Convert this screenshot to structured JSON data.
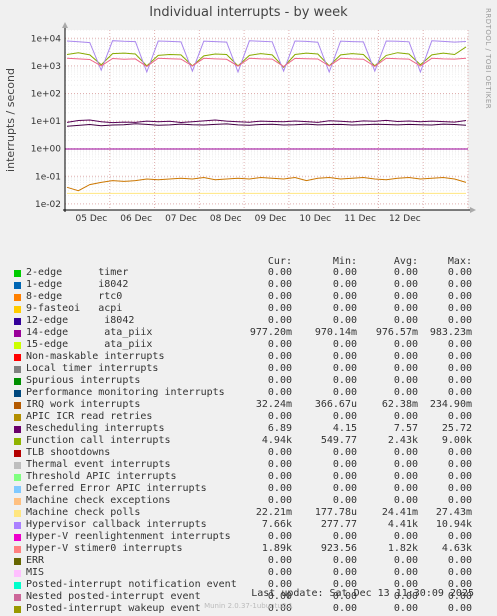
{
  "title": "Individual interrupts - by week",
  "side_label": "RRDTOOL / TOBI OETIKER",
  "chart_data": {
    "type": "line",
    "title": "Individual interrupts - by week",
    "ylabel": "interrupts / second",
    "yscale": "log",
    "ylim": [
      0.006,
      20000
    ],
    "ytick_labels": [
      "1e+04",
      "1e+03",
      "1e+02",
      "1e+01",
      "1e+00",
      "1e-01",
      "1e-02"
    ],
    "ytick_values": [
      10000,
      1000,
      100,
      10,
      1,
      0.1,
      0.01
    ],
    "xtick_labels": [
      "05 Dec",
      "06 Dec",
      "07 Dec",
      "08 Dec",
      "09 Dec",
      "10 Dec",
      "11 Dec",
      "12 Dec"
    ],
    "x_start": "2025-12-04",
    "x_end": "2025-12-13",
    "series": [
      {
        "name": "14-edge ata_piix",
        "color": "#550055",
        "typical": 9.7,
        "min": 0.97014,
        "max": 0.98323,
        "points": [
          9.0,
          10.5,
          11.0,
          9.5,
          8.8,
          9.2,
          9.0,
          10.0,
          9.4,
          9.8,
          8.9,
          9.5,
          10.2,
          11.0,
          10.0,
          9.5,
          9.1,
          10.0,
          9.7,
          9.5,
          10.1,
          9.6,
          9.0,
          10.3,
          9.9,
          9.3,
          10.2,
          9.8,
          10.6,
          9.7,
          10.1,
          9.4,
          10.0,
          9.6,
          9.2,
          10.5
        ]
      },
      {
        "name": "IRQ work interrupts",
        "color": "#cc7700",
        "typical": 0.032,
        "points": [
          0.04,
          0.03,
          0.05,
          0.06,
          0.07,
          0.065,
          0.07,
          0.08,
          0.075,
          0.08,
          0.085,
          0.08,
          0.09,
          0.075,
          0.08,
          0.085,
          0.08,
          0.09,
          0.085,
          0.08,
          0.09,
          0.07,
          0.085,
          0.09,
          0.08,
          0.085,
          0.09,
          0.08,
          0.075,
          0.085,
          0.09,
          0.08,
          0.085,
          0.09,
          0.08,
          0.06
        ]
      },
      {
        "name": "Rescheduling interrupts",
        "color": "#440044",
        "typical": 6.89,
        "points": [
          6.5,
          7.0,
          7.5,
          6.8,
          7.2,
          7.4,
          8.0,
          7.6,
          7.1,
          7.3,
          7.8,
          7.4,
          7.2,
          7.6,
          7.9,
          7.3,
          7.1,
          7.5,
          7.7,
          7.2,
          7.4,
          7.8,
          7.3,
          7.5,
          7.6,
          7.2,
          7.4,
          7.7,
          7.5,
          7.3,
          7.6,
          7.4,
          7.2,
          7.8,
          7.5,
          7.1
        ]
      },
      {
        "name": "Function call interrupts",
        "color": "#88aa00",
        "typical": 4940,
        "points": [
          2600,
          3000,
          2500,
          1100,
          2800,
          2900,
          2700,
          1000,
          2400,
          2600,
          2500,
          1000,
          2300,
          2700,
          2600,
          1000,
          2400,
          2800,
          2500,
          900,
          2600,
          2900,
          2700,
          1000,
          2500,
          2800,
          2600,
          1000,
          2400,
          3000,
          2700,
          1100,
          2500,
          2900,
          2600,
          4900
        ]
      },
      {
        "name": "Machine check polls",
        "color": "#ffe680",
        "typical": 0.02221,
        "points": [
          0.024,
          0.024,
          0.024,
          0.024,
          0.024,
          0.024,
          0.024,
          0.024,
          0.024,
          0.024,
          0.024,
          0.024,
          0.024,
          0.024,
          0.024,
          0.024,
          0.024,
          0.024,
          0.024,
          0.024,
          0.024,
          0.024,
          0.024,
          0.024,
          0.024,
          0.024,
          0.024,
          0.024,
          0.024,
          0.024,
          0.024,
          0.024,
          0.024,
          0.024,
          0.024,
          0.024
        ]
      },
      {
        "name": "Hypervisor callback interrupts",
        "color": "#aa88ee",
        "typical": 7660,
        "points": [
          8000,
          7500,
          7000,
          700,
          8200,
          7800,
          7600,
          600,
          8000,
          7700,
          7400,
          650,
          7900,
          7600,
          7300,
          600,
          8100,
          7800,
          7500,
          650,
          8000,
          7700,
          7200,
          600,
          7900,
          7600,
          7400,
          650,
          8000,
          7800,
          7500,
          600,
          8100,
          7700,
          7300,
          7660
        ]
      },
      {
        "name": "Hyper-V stimer0 interrupts",
        "color": "#ee6688",
        "typical": 1890,
        "points": [
          1900,
          1800,
          1700,
          1000,
          1850,
          1750,
          1800,
          950,
          1900,
          1820,
          1760,
          1000,
          1880,
          1790,
          1740,
          980,
          1900,
          1800,
          1760,
          950,
          1870,
          1820,
          1780,
          1000,
          1890,
          1800,
          1750,
          960,
          1900,
          1810,
          1770,
          990,
          1880,
          1800,
          1760,
          1890
        ]
      }
    ]
  },
  "legend": {
    "headers": {
      "cur": "Cur:",
      "min": "Min:",
      "avg": "Avg:",
      "max": "Max:"
    },
    "rows": [
      {
        "label": "2-edge      timer",
        "color": "#00cc00",
        "cur": "0.00",
        "min": "0.00",
        "avg": "0.00",
        "max": "0.00"
      },
      {
        "label": "1-edge      i8042",
        "color": "#0066b3",
        "cur": "0.00",
        "min": "0.00",
        "avg": "0.00",
        "max": "0.00"
      },
      {
        "label": "8-edge      rtc0",
        "color": "#ff8000",
        "cur": "0.00",
        "min": "0.00",
        "avg": "0.00",
        "max": "0.00"
      },
      {
        "label": "9-fasteoi   acpi",
        "color": "#ffcc00",
        "cur": "0.00",
        "min": "0.00",
        "avg": "0.00",
        "max": "0.00"
      },
      {
        "label": "12-edge      i8042",
        "color": "#330099",
        "cur": "0.00",
        "min": "0.00",
        "avg": "0.00",
        "max": "0.00"
      },
      {
        "label": "14-edge      ata_piix",
        "color": "#990099",
        "cur": "977.20m",
        "min": "970.14m",
        "avg": "976.57m",
        "max": "983.23m"
      },
      {
        "label": "15-edge      ata_piix",
        "color": "#ccff00",
        "cur": "0.00",
        "min": "0.00",
        "avg": "0.00",
        "max": "0.00"
      },
      {
        "label": "Non-maskable interrupts",
        "color": "#ff0000",
        "cur": "0.00",
        "min": "0.00",
        "avg": "0.00",
        "max": "0.00"
      },
      {
        "label": "Local timer interrupts",
        "color": "#808080",
        "cur": "0.00",
        "min": "0.00",
        "avg": "0.00",
        "max": "0.00"
      },
      {
        "label": "Spurious interrupts",
        "color": "#008f00",
        "cur": "0.00",
        "min": "0.00",
        "avg": "0.00",
        "max": "0.00"
      },
      {
        "label": "Performance monitoring interrupts",
        "color": "#00487d",
        "cur": "0.00",
        "min": "0.00",
        "avg": "0.00",
        "max": "0.00"
      },
      {
        "label": "IRQ work interrupts",
        "color": "#b35a00",
        "cur": "32.24m",
        "min": "366.67u",
        "avg": "62.38m",
        "max": "234.90m"
      },
      {
        "label": "APIC ICR read retries",
        "color": "#b38f00",
        "cur": "0.00",
        "min": "0.00",
        "avg": "0.00",
        "max": "0.00"
      },
      {
        "label": "Rescheduling interrupts",
        "color": "#6b006b",
        "cur": "6.89",
        "min": "4.15",
        "avg": "7.57",
        "max": "25.72"
      },
      {
        "label": "Function call interrupts",
        "color": "#8fb300",
        "cur": "4.94k",
        "min": "549.77",
        "avg": "2.43k",
        "max": "9.00k"
      },
      {
        "label": "TLB shootdowns",
        "color": "#b30000",
        "cur": "0.00",
        "min": "0.00",
        "avg": "0.00",
        "max": "0.00"
      },
      {
        "label": "Thermal event interrupts",
        "color": "#bebebe",
        "cur": "0.00",
        "min": "0.00",
        "avg": "0.00",
        "max": "0.00"
      },
      {
        "label": "Threshold APIC interrupts",
        "color": "#80ff80",
        "cur": "0.00",
        "min": "0.00",
        "avg": "0.00",
        "max": "0.00"
      },
      {
        "label": "Deferred Error APIC interrupts",
        "color": "#80c9ff",
        "cur": "0.00",
        "min": "0.00",
        "avg": "0.00",
        "max": "0.00"
      },
      {
        "label": "Machine check exceptions",
        "color": "#ffc080",
        "cur": "0.00",
        "min": "0.00",
        "avg": "0.00",
        "max": "0.00"
      },
      {
        "label": "Machine check polls",
        "color": "#ffe680",
        "cur": "22.21m",
        "min": "177.78u",
        "avg": "24.41m",
        "max": "27.43m"
      },
      {
        "label": "Hypervisor callback interrupts",
        "color": "#aa80ff",
        "cur": "7.66k",
        "min": "277.77",
        "avg": "4.41k",
        "max": "10.94k"
      },
      {
        "label": "Hyper-V reenlightenment interrupts",
        "color": "#ee00cc",
        "cur": "0.00",
        "min": "0.00",
        "avg": "0.00",
        "max": "0.00"
      },
      {
        "label": "Hyper-V stimer0 interrupts",
        "color": "#ff8080",
        "cur": "1.89k",
        "min": "923.56",
        "avg": "1.82k",
        "max": "4.63k"
      },
      {
        "label": "ERR",
        "color": "#666600",
        "cur": "0.00",
        "min": "0.00",
        "avg": "0.00",
        "max": "0.00"
      },
      {
        "label": "MIS",
        "color": "#ffbfff",
        "cur": "0.00",
        "min": "0.00",
        "avg": "0.00",
        "max": "0.00"
      },
      {
        "label": "Posted-interrupt notification event",
        "color": "#00ffcc",
        "cur": "0.00",
        "min": "0.00",
        "avg": "0.00",
        "max": "0.00"
      },
      {
        "label": "Nested posted-interrupt event",
        "color": "#cc6699",
        "cur": "0.00",
        "min": "0.00",
        "avg": "0.00",
        "max": "0.00"
      },
      {
        "label": "Posted-interrupt wakeup event",
        "color": "#999900",
        "cur": "0.00",
        "min": "0.00",
        "avg": "0.00",
        "max": "0.00"
      }
    ]
  },
  "last_update": "Last update: Sat Dec 13 11:30:09 2025",
  "footer": "Munin 2.0.37-1ubuntu0.1"
}
